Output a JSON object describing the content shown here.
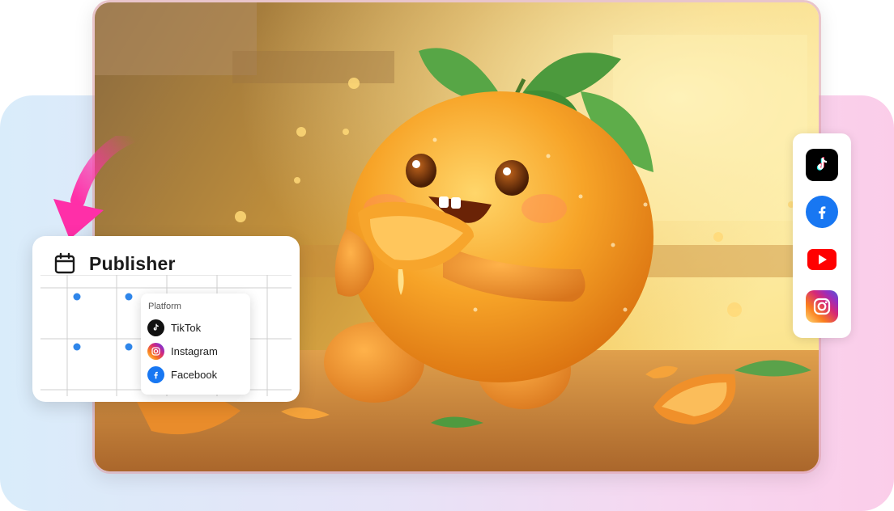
{
  "publisher": {
    "title": "Publisher",
    "icon": "calendar-icon",
    "platform_popup": {
      "title": "Platform",
      "items": [
        {
          "label": "TikTok",
          "icon": "tiktok-icon"
        },
        {
          "label": "Instagram",
          "icon": "instagram-icon"
        },
        {
          "label": "Facebook",
          "icon": "facebook-icon"
        }
      ]
    }
  },
  "social_bar": {
    "items": [
      {
        "name": "TikTok",
        "icon": "tiktok-icon"
      },
      {
        "name": "Facebook",
        "icon": "facebook-icon"
      },
      {
        "name": "YouTube",
        "icon": "youtube-icon"
      },
      {
        "name": "Instagram",
        "icon": "instagram-icon"
      }
    ]
  },
  "hero": {
    "image": "orange-character-illustration"
  },
  "colors": {
    "accent_arrow": "#ff2fa8",
    "grid_dot": "#2f86ea",
    "facebook": "#1877f2",
    "youtube": "#ff0000",
    "tiktok": "#000000"
  }
}
